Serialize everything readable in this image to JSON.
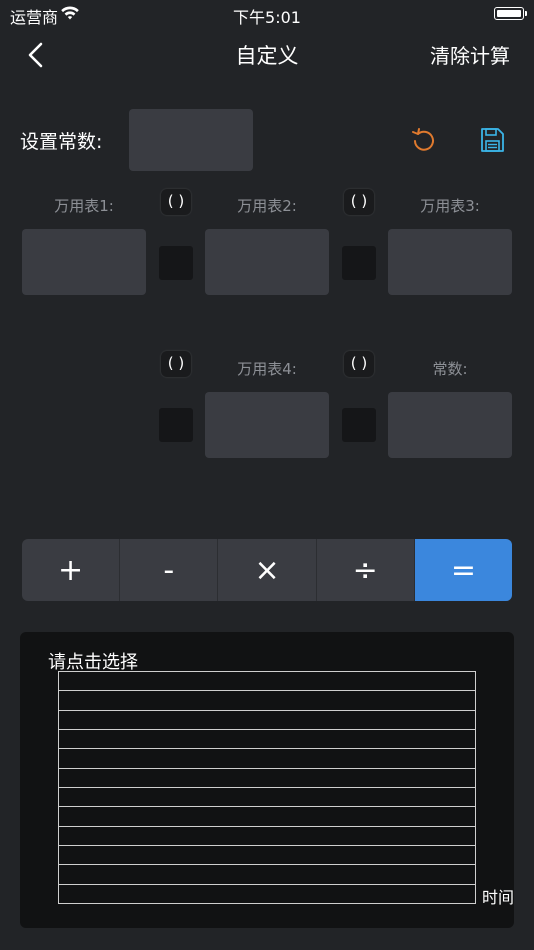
{
  "status_bar": {
    "carrier": "运营商",
    "time": "下午5:01"
  },
  "nav": {
    "title": "自定义",
    "clear_button": "清除计算"
  },
  "constant": {
    "label": "设置常数:",
    "value": ""
  },
  "meters": {
    "m1": "万用表1:",
    "m2": "万用表2:",
    "m3": "万用表3:",
    "m4": "万用表4:",
    "const": "常数:"
  },
  "paren": "( )",
  "operators": {
    "plus": "+",
    "minus": "-",
    "times": "×",
    "divide": "÷",
    "equals": "="
  },
  "colors": {
    "accent_blue": "#3b87dd",
    "refresh_orange": "#e07a2e",
    "save_cyan": "#3bb5e8"
  },
  "chart": {
    "prompt": "请点击选择",
    "x_axis_label": "时间",
    "rows": 12
  }
}
